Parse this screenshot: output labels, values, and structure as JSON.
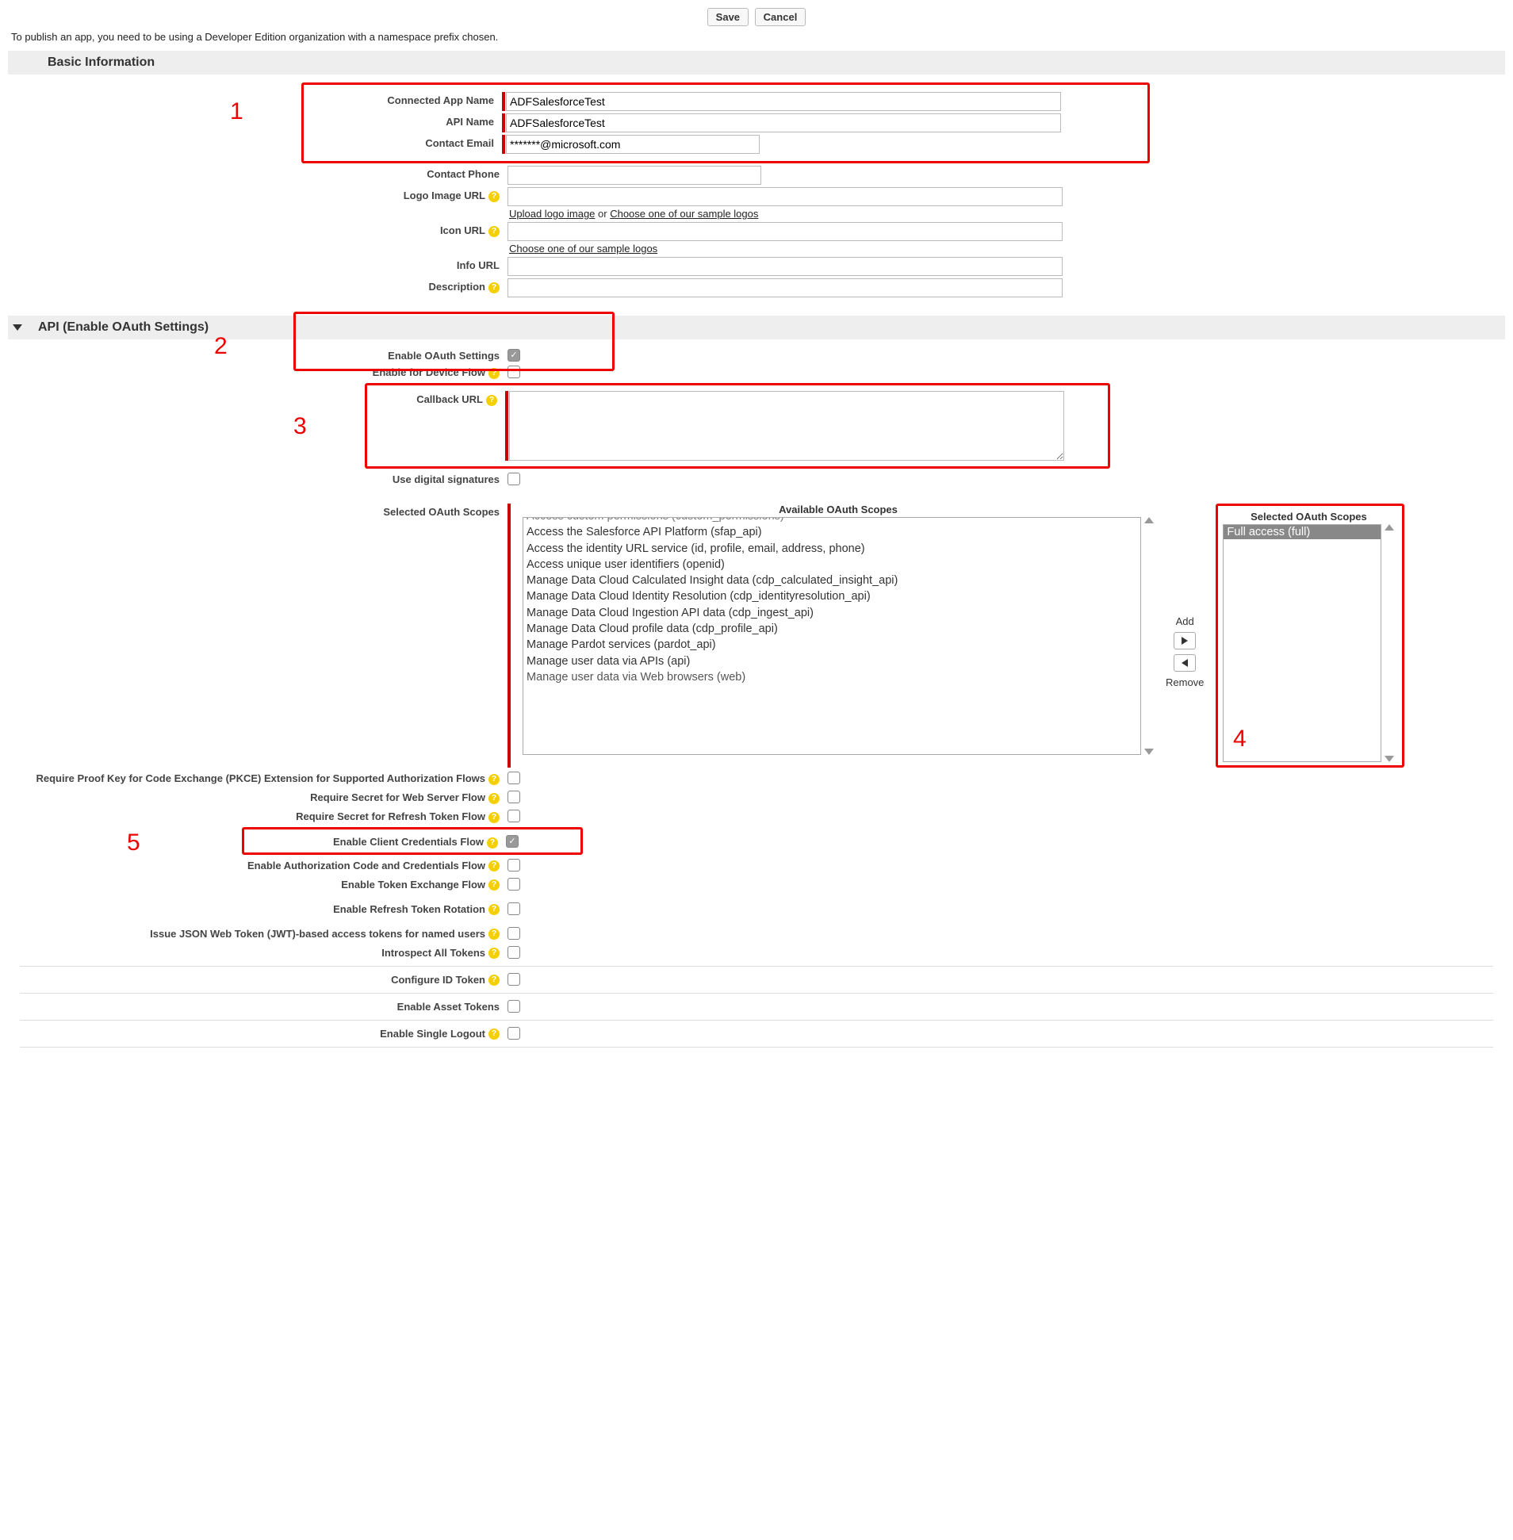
{
  "buttons": {
    "save": "Save",
    "cancel": "Cancel"
  },
  "intro": "To publish an app, you need to be using a Developer Edition organization with a namespace prefix chosen.",
  "sections": {
    "basic": "Basic Information",
    "api": "API (Enable OAuth Settings)"
  },
  "annotations": {
    "n1": "1",
    "n2": "2",
    "n3": "3",
    "n4": "4",
    "n5": "5"
  },
  "basic": {
    "connectedAppName": {
      "label": "Connected App Name",
      "value": "ADFSalesforceTest"
    },
    "apiName": {
      "label": "API Name",
      "value": "ADFSalesforceTest"
    },
    "contactEmail": {
      "label": "Contact Email",
      "value": "*******@microsoft.com"
    },
    "contactPhone": {
      "label": "Contact Phone",
      "value": ""
    },
    "logoUrl": {
      "label": "Logo Image URL",
      "value": "",
      "uploadLink": "Upload logo image",
      "or": " or ",
      "chooseLink": "Choose one of our sample logos"
    },
    "iconUrl": {
      "label": "Icon URL",
      "value": "",
      "chooseLink": "Choose one of our sample logos"
    },
    "infoUrl": {
      "label": "Info URL",
      "value": ""
    },
    "description": {
      "label": "Description",
      "value": ""
    }
  },
  "api": {
    "enableOAuth": {
      "label": "Enable OAuth Settings",
      "checked": true
    },
    "enableDeviceFlow": {
      "label": "Enable for Device Flow",
      "checked": false
    },
    "callbackUrl": {
      "label": "Callback URL",
      "value": ""
    },
    "useDigitalSig": {
      "label": "Use digital signatures",
      "checked": false
    },
    "scopesLabel": "Selected OAuth Scopes",
    "availableTitle": "Available OAuth Scopes",
    "selectedTitle": "Selected OAuth Scopes",
    "addLabel": "Add",
    "removeLabel": "Remove",
    "availableScopes": [
      "Access custom permissions (custom_permissions)",
      "Access the Salesforce API Platform (sfap_api)",
      "Access the identity URL service (id, profile, email, address, phone)",
      "Access unique user identifiers (openid)",
      "Manage Data Cloud Calculated Insight data (cdp_calculated_insight_api)",
      "Manage Data Cloud Identity Resolution (cdp_identityresolution_api)",
      "Manage Data Cloud Ingestion API data (cdp_ingest_api)",
      "Manage Data Cloud profile data (cdp_profile_api)",
      "Manage Pardot services (pardot_api)",
      "Manage user data via APIs (api)",
      "Manage user data via Web browsers (web)"
    ],
    "selectedScopes": [
      "Full access (full)"
    ],
    "flags": {
      "pkce": {
        "label": "Require Proof Key for Code Exchange (PKCE) Extension for Supported Authorization Flows",
        "checked": false
      },
      "secretWeb": {
        "label": "Require Secret for Web Server Flow",
        "checked": false
      },
      "secretRefresh": {
        "label": "Require Secret for Refresh Token Flow",
        "checked": false
      },
      "clientCreds": {
        "label": "Enable Client Credentials Flow",
        "checked": true
      },
      "authCodeCreds": {
        "label": "Enable Authorization Code and Credentials Flow",
        "checked": false
      },
      "tokenExchange": {
        "label": "Enable Token Exchange Flow",
        "checked": false
      },
      "refreshRotation": {
        "label": "Enable Refresh Token Rotation",
        "checked": false
      },
      "jwtNamedUsers": {
        "label": "Issue JSON Web Token (JWT)-based access tokens for named users",
        "checked": false
      },
      "introspectAll": {
        "label": "Introspect All Tokens",
        "checked": false
      },
      "configureId": {
        "label": "Configure ID Token",
        "checked": false
      },
      "assetTokens": {
        "label": "Enable Asset Tokens",
        "checked": false
      },
      "singleLogout": {
        "label": "Enable Single Logout",
        "checked": false
      }
    }
  }
}
